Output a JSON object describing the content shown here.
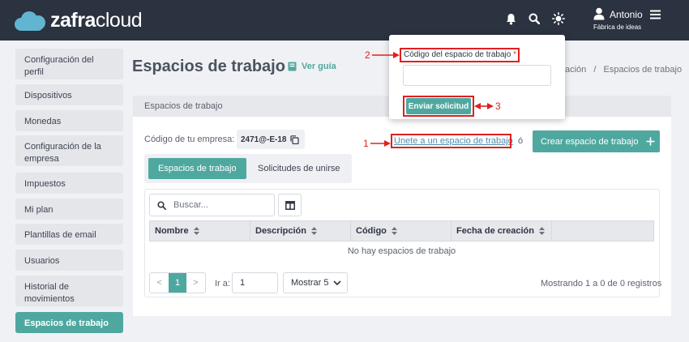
{
  "header": {
    "logo_bold": "zafra",
    "logo_light": "cloud",
    "user_name": "Antonio",
    "user_company": "Fábrica de ideas",
    "icons": [
      "bell-icon",
      "search-icon",
      "sun-icon",
      "user-icon",
      "menu-icon"
    ]
  },
  "sidebar": {
    "items": [
      {
        "label": "Configuración del perfil"
      },
      {
        "label": "Dispositivos"
      },
      {
        "label": "Monedas"
      },
      {
        "label": "Configuración de la empresa"
      },
      {
        "label": "Impuestos"
      },
      {
        "label": "Mi plan"
      },
      {
        "label": "Plantillas de email"
      },
      {
        "label": "Usuarios"
      },
      {
        "label": "Historial de movimientos"
      },
      {
        "label": "Espacios de trabajo"
      }
    ],
    "active_index": 9
  },
  "main": {
    "title": "Espacios de trabajo",
    "guide_label": "Ver guía",
    "breadcrumb_partial": "ación",
    "breadcrumb_separator": "/",
    "breadcrumb_current": "Espacios de trabajo",
    "card_title": "Espacios de trabajo",
    "company_code_label": "Código de tu empresa:",
    "company_code": "2471@-E-18",
    "join_link": "Unete a un espacio de trabajo",
    "or_text": "ó",
    "create_button": "Crear espacio de trabajo",
    "tabs": [
      {
        "label": "Espacios de trabajo",
        "active": true
      },
      {
        "label": "Solicitudes de unirse",
        "active": false
      }
    ],
    "search_placeholder": "Buscar...",
    "columns": [
      "Nombre",
      "Descripción",
      "Código",
      "Fecha de creación",
      ""
    ],
    "empty_message": "No hay espacios de trabajo",
    "pagination": {
      "prev": "<",
      "current": "1",
      "next": ">"
    },
    "goto_label": "Ir a:",
    "goto_value": "1",
    "show_select": "Mostrar 5",
    "records_text": "Mostrando 1 a 0 de 0 registros"
  },
  "popup": {
    "field_label": "Código del espacio de trabajo",
    "required_mark": "*",
    "field_value": "",
    "send_button": "Enviar solicitud"
  },
  "annotations": {
    "n1": "1",
    "n2": "2",
    "n3": "3"
  },
  "colors": {
    "topbar": "#2b3240",
    "accent": "#4fa8a0",
    "annotation": "#e02020",
    "logo_cloud": "#62b5d0"
  }
}
